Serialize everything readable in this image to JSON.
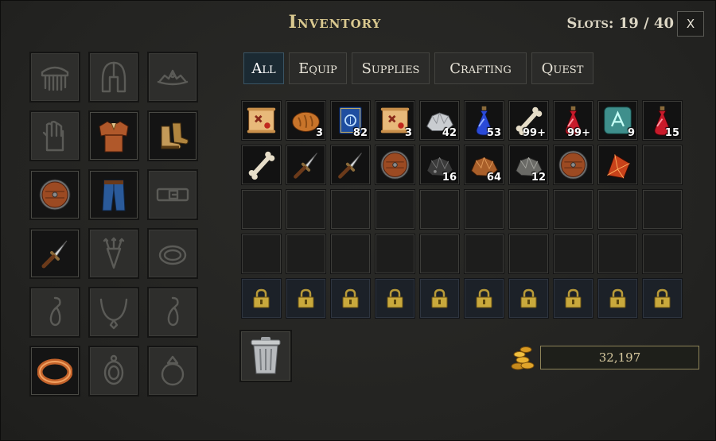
{
  "window": {
    "title": "Inventory",
    "slots_text": "Slots: 19 / 40",
    "close_label": "X"
  },
  "tabs": [
    {
      "label": "All",
      "active": true
    },
    {
      "label": "Equip",
      "active": false
    },
    {
      "label": "Supplies",
      "active": false
    },
    {
      "label": "Crafting",
      "active": false
    },
    {
      "label": "Quest",
      "active": false
    }
  ],
  "equipment": [
    {
      "slot": "hair",
      "icon": "comb-icon",
      "filled": false
    },
    {
      "slot": "head",
      "icon": "helmet-icon",
      "filled": false
    },
    {
      "slot": "circlet",
      "icon": "tiara-icon",
      "filled": false
    },
    {
      "slot": "hands",
      "icon": "glove-icon",
      "filled": false
    },
    {
      "slot": "chest",
      "icon": "tunic-icon",
      "filled": true
    },
    {
      "slot": "feet",
      "icon": "boots-icon",
      "filled": true
    },
    {
      "slot": "offhand",
      "icon": "round-shield-icon",
      "filled": true
    },
    {
      "slot": "legs",
      "icon": "pants-icon",
      "filled": true
    },
    {
      "slot": "waist",
      "icon": "belt-icon",
      "filled": false
    },
    {
      "slot": "weapon",
      "icon": "dagger-icon",
      "filled": true
    },
    {
      "slot": "quiver",
      "icon": "quiver-icon",
      "filled": false
    },
    {
      "slot": "bracelet",
      "icon": "bracelet-icon",
      "filled": false
    },
    {
      "slot": "earring-left",
      "icon": "earring-icon",
      "filled": false
    },
    {
      "slot": "necklace",
      "icon": "necklace-icon",
      "filled": false
    },
    {
      "slot": "earring-right",
      "icon": "earring-icon",
      "filled": false
    },
    {
      "slot": "ring-left",
      "icon": "copper-ring-icon",
      "filled": true
    },
    {
      "slot": "amulet",
      "icon": "pendant-icon",
      "filled": false
    },
    {
      "slot": "ring-right",
      "icon": "ring-icon",
      "filled": false
    }
  ],
  "inventory": [
    {
      "icon": "scroll-map-icon",
      "qty": ""
    },
    {
      "icon": "bread-icon",
      "qty": "3"
    },
    {
      "icon": "blue-tome-icon",
      "qty": "82"
    },
    {
      "icon": "scroll-map-icon",
      "qty": "3"
    },
    {
      "icon": "silver-ore-icon",
      "qty": "42"
    },
    {
      "icon": "blue-potion-icon",
      "qty": "53"
    },
    {
      "icon": "bone-icon",
      "qty": "99+"
    },
    {
      "icon": "red-potion-icon",
      "qty": "99+"
    },
    {
      "icon": "rune-stone-icon",
      "qty": "9"
    },
    {
      "icon": "red-potion-icon",
      "qty": "15"
    },
    {
      "icon": "bone-icon",
      "qty": ""
    },
    {
      "icon": "dagger-icon",
      "qty": ""
    },
    {
      "icon": "dagger-icon",
      "qty": ""
    },
    {
      "icon": "round-shield-icon",
      "qty": ""
    },
    {
      "icon": "coal-ore-icon",
      "qty": "16"
    },
    {
      "icon": "copper-ore-icon",
      "qty": "64"
    },
    {
      "icon": "iron-ore-icon",
      "qty": "12"
    },
    {
      "icon": "round-shield-icon",
      "qty": ""
    },
    {
      "icon": "fire-crystal-icon",
      "qty": ""
    }
  ],
  "grid": {
    "columns": 10,
    "empty_slots": 21,
    "locked_slots": 10
  },
  "gold": {
    "amount": "32,197",
    "icon": "gold-coins-icon"
  },
  "trash": {
    "icon": "trash-can-icon"
  },
  "colors": {
    "title": "#d9c88f",
    "active_tab": "#1b2a33",
    "locked_slot": "#1c2128",
    "gold_border": "#8d8358"
  }
}
